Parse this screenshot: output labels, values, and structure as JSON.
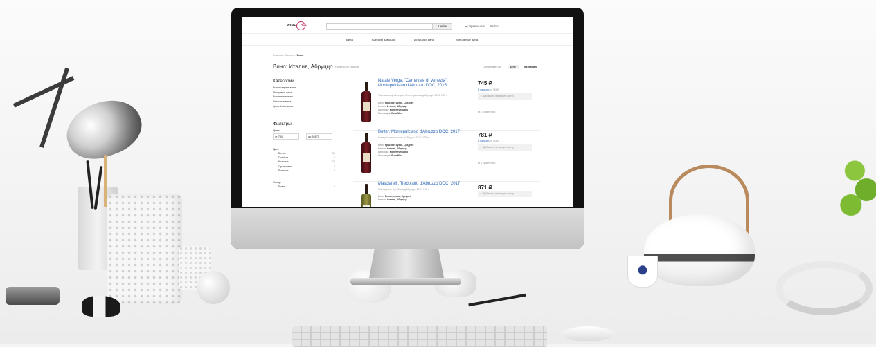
{
  "site": {
    "logo": {
      "word": "WINE",
      "accent": "CHEF",
      "accent_color": "#c0285a"
    },
    "search": {
      "placeholder": "",
      "button": "Найти"
    },
    "header_links": {
      "compare": "Сравнение",
      "login": "Войти"
    },
    "nav": [
      "Вина",
      "Крепкий алкоголь",
      "Игристые вина",
      "Креплёные вина"
    ]
  },
  "page": {
    "breadcrumb_prefix": "Главная / Каталог /",
    "breadcrumb_current": "Вино",
    "title": "Вино: Италия, Абруццо",
    "found": "Найдено 30 товаров",
    "sort": {
      "label": "Сортировать по:",
      "price": "цене ↑",
      "name": "названию"
    }
  },
  "sidebar": {
    "categories_title": "Категории",
    "categories": [
      "Виноградные вина",
      "Плодовые вина",
      "Винные напитки",
      "Игристые вина",
      "Креплёные вина"
    ],
    "filters_title": "Фильтры",
    "price_label": "Цена",
    "price_from": "от 780",
    "price_to": "до 39175",
    "color_label": "Цвет",
    "colors": [
      {
        "name": "Белое",
        "count": "39"
      },
      {
        "name": "Голубое",
        "count": "0"
      },
      {
        "name": "Красное",
        "count": "22"
      },
      {
        "name": "Оранжевое",
        "count": "0"
      },
      {
        "name": "Розовое",
        "count": "4"
      }
    ],
    "sugar_label": "Сахар",
    "sugar": [
      {
        "name": "Брют",
        "count": "0"
      }
    ]
  },
  "products": [
    {
      "title": "Natale Verga, \"Carnevale di Venezia\", Montepulciano d'Abruzzo DOC, 2015",
      "subtitle": "\"Карнавале ди Венеция\", Монтепульчано д'Абруццо, 2015, 0,75 л",
      "attrs": [
        {
          "k": "Вино:",
          "v": "Красное, сухое, Среднее"
        },
        {
          "k": "Регион:",
          "v": "Италия, Абруццо"
        },
        {
          "k": "Виноград:",
          "v": "Монтепульчано"
        },
        {
          "k": "Поставщик:",
          "v": "EuroWine"
        }
      ],
      "price": "745 ₽",
      "stock": "В наличии",
      "stock_extra": "от 745 ₽",
      "cart": "Добавить в винную карту",
      "compare": "К сравнению"
    },
    {
      "title": "Botter, Montepulciano d'Abruzzo DOC, 2017",
      "subtitle": "Боттер, Монтепульчано д'Абруццо, 2017, 0,75 л",
      "attrs": [
        {
          "k": "Вино:",
          "v": "Красное, сухое, Среднее"
        },
        {
          "k": "Регион:",
          "v": "Италия, Абруццо"
        },
        {
          "k": "Виноград:",
          "v": "Монтепульчано"
        },
        {
          "k": "Поставщик:",
          "v": "EuroWine"
        }
      ],
      "price": "781 ₽",
      "stock": "В наличии",
      "stock_extra": "от 781 ₽",
      "cart": "Добавить в винную карту",
      "compare": "К сравнению"
    },
    {
      "title": "Masciarelli, Trebbiano d'Abruzzo DOC, 2017",
      "subtitle": "Масчарелли, Треббьяно д'Абруццо, 2017, 0,75 л",
      "attrs": [
        {
          "k": "Вино:",
          "v": "Белое, сухое, Среднее"
        },
        {
          "k": "Регион:",
          "v": "Италия, Абруццо"
        }
      ],
      "price": "871 ₽",
      "cart": "Добавить в винную карту"
    }
  ]
}
